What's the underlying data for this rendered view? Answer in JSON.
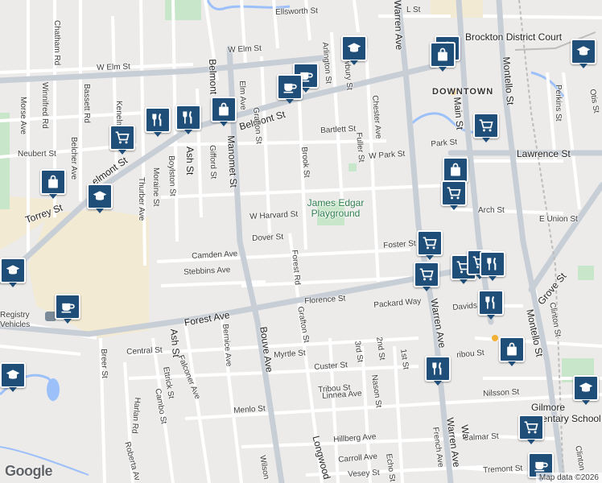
{
  "map": {
    "attribution": "Map data ©2026",
    "logo": "Google",
    "labels": {
      "ellsworth": "Ellsworth St",
      "l_st": "L St",
      "brockton_court": "Brockton District Court",
      "chatham": "Chatham Rd",
      "w_elm_left": "W Elm St",
      "w_elm_right": "W Elm St",
      "arlington": "Arlington St",
      "newbury": "Newbury St",
      "warren_top": "Warren Ave",
      "main_top": "Main St",
      "montello_top": "Montello St",
      "perkins": "Perkins St",
      "otis": "Otis St",
      "morse": "Morse Ave",
      "winnifred": "Winnifred Rd",
      "bassett": "Bassett Rd",
      "kenelm": "Kenelm St",
      "belmont_vertical": "Belmont",
      "elm_ave": "Elm Ave",
      "belmont_st": "Belmont St",
      "grafton_top": "Grafton St",
      "chester": "Chester Ave",
      "downtown": "DOWNTOWN",
      "bartlett": "Bartlett St",
      "fuller": "Fuller St",
      "park_st": "Park St",
      "neubert": "Neubert St",
      "belcher": "Belcher Ave",
      "belmont_st_left": "elmont St",
      "ash_st": "Ash St",
      "gifford": "Gifford St",
      "boylston": "Boylston St",
      "manomet": "Manomet St",
      "brook": "Brook St",
      "w_park": "W Park St",
      "lawrence": "Lawrence St",
      "moraine": "Moraine St",
      "thurber": "Thurber Ave",
      "torrey": "Torrey St",
      "w_harvard": "W Harvard St",
      "park_name": "James Edgar Playground",
      "arch": "Arch St",
      "e_union": "E Union St",
      "dover": "Dover St",
      "camden": "Camden Ave",
      "forest_rd": "Forest Rd",
      "foster": "Foster St",
      "stebbins": "Stebbins Ave",
      "grove": "Grove St",
      "registry": "Registry\nVehicles",
      "forest_ave": "Forest Ave",
      "florence": "Florence St",
      "packard": "Packard Way",
      "davids": "Davids St",
      "clinton_right": "Clinton St",
      "warren_mid": "Warren Ave",
      "montello_bottom": "Montello St",
      "central": "Central St",
      "ash_lower": "Ash St",
      "bernice": "Bernice Ave",
      "bouve": "Bouve Ave",
      "grafton_lower": "Grafton St",
      "myrtle": "Myrtle St",
      "third": "3rd St",
      "second": "2nd St",
      "first": "1st St",
      "custer": "Custer St",
      "caribou": "ribou St",
      "breer": "Breer St",
      "falconer": "Falconer Ave",
      "ettrick": "Ettrick St",
      "cambo": "Cambo St",
      "harlan": "Harlan Rd",
      "menlo": "Menlo St",
      "tribou": "Tribou St",
      "linnea": "Linnea Ave",
      "nason": "Nason St",
      "nilsson": "Nilsson St",
      "gilmore": "Gilmore",
      "elementary": "Elementary School",
      "longwood": "Longwood",
      "wilson": "Wilson",
      "roberta": "Roberta Av",
      "hillberg": "Hillberg Ave",
      "calmar": "Calmar St",
      "carroll": "Carroll Ave",
      "echo": "Echo St",
      "french": "French Ave",
      "warren_bottom": "Warren Ave",
      "warren_bottom2": "Wa",
      "tremont": "Tremont St",
      "vesey": "Vesey St",
      "clinton_bottom": "Clinton"
    },
    "colors": {
      "land": "#ecebe9",
      "road": "#ffffff",
      "major_road": "#c7ced6",
      "park": "#c8e6c9",
      "campus": "#f3ead3",
      "water": "#9cc0f9",
      "rail": "#bcbcbc",
      "marker": "#1f4e79"
    },
    "markers": [
      {
        "name": "school-marker",
        "icon": "school-icon"
      },
      {
        "name": "shopping-bag-marker",
        "icon": "shopping-bag-icon"
      },
      {
        "name": "shopping-bag-marker",
        "icon": "shopping-bag-icon"
      },
      {
        "name": "school-marker",
        "icon": "school-icon"
      },
      {
        "name": "cafe-marker",
        "icon": "coffee-cup-icon"
      },
      {
        "name": "cafe-marker",
        "icon": "coffee-cup-icon"
      },
      {
        "name": "restaurant-marker",
        "icon": "fork-knife-icon"
      },
      {
        "name": "restaurant-marker",
        "icon": "fork-knife-icon"
      },
      {
        "name": "shopping-bag-marker",
        "icon": "shopping-bag-icon"
      },
      {
        "name": "grocery-marker",
        "icon": "shopping-cart-icon"
      },
      {
        "name": "shopping-bag-marker",
        "icon": "shopping-bag-icon"
      },
      {
        "name": "school-marker",
        "icon": "school-icon"
      },
      {
        "name": "grocery-marker",
        "icon": "shopping-cart-icon"
      },
      {
        "name": "shopping-bag-marker",
        "icon": "shopping-bag-icon"
      },
      {
        "name": "grocery-marker",
        "icon": "shopping-cart-icon"
      },
      {
        "name": "grocery-marker",
        "icon": "shopping-cart-icon"
      },
      {
        "name": "grocery-marker",
        "icon": "shopping-cart-icon"
      },
      {
        "name": "grocery-marker",
        "icon": "shopping-cart-icon"
      },
      {
        "name": "restaurant-marker",
        "icon": "fork-knife-icon"
      },
      {
        "name": "grocery-marker",
        "icon": "shopping-cart-icon"
      },
      {
        "name": "restaurant-marker",
        "icon": "fork-knife-icon"
      },
      {
        "name": "shopping-bag-marker",
        "icon": "shopping-bag-icon"
      },
      {
        "name": "restaurant-marker",
        "icon": "fork-knife-icon"
      },
      {
        "name": "school-marker",
        "icon": "school-icon"
      },
      {
        "name": "grocery-marker",
        "icon": "shopping-cart-icon"
      },
      {
        "name": "cafe-marker",
        "icon": "coffee-cup-icon"
      },
      {
        "name": "cafe-marker",
        "icon": "coffee-cup-icon"
      },
      {
        "name": "school-marker",
        "icon": "school-icon"
      },
      {
        "name": "school-marker",
        "icon": "school-icon"
      }
    ]
  }
}
